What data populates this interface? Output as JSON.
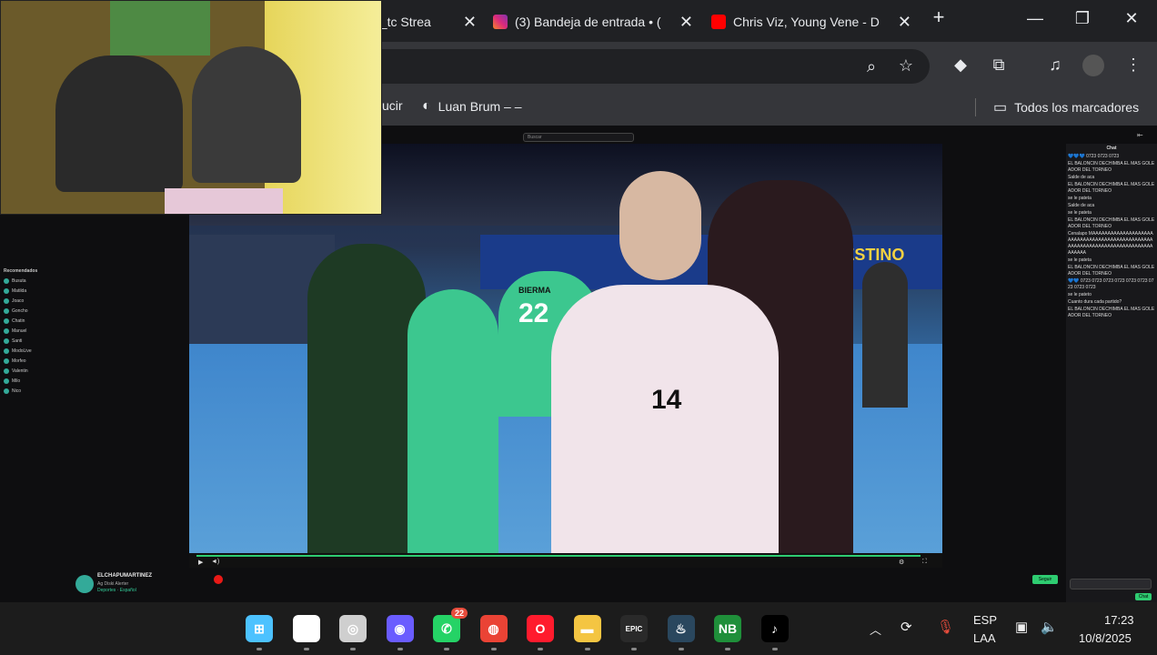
{
  "browser": {
    "tabs": [
      {
        "title": "a_tc Strea",
        "favicon_color": "#9146ff"
      },
      {
        "title": "(3) Bandeja de entrada • (",
        "favicon_color": "#e1306c"
      },
      {
        "title": "Chris Viz, Young Vene - D",
        "favicon_color": "#ff0000"
      }
    ],
    "new_tab_label": "+",
    "window_controls": {
      "minimize": "—",
      "maximize": "❐",
      "close": "✕"
    },
    "bookmarks": [
      {
        "label": "ucir",
        "icon": "bookmark"
      },
      {
        "label": "Luan Brum – –",
        "icon": "globe-icon"
      }
    ],
    "all_bookmarks_label": "Todos los marcadores"
  },
  "stream": {
    "search_placeholder": "Buscar",
    "channel_name": "ELCHAPUMARTINEZ",
    "channel_subtitle": "Ag Diski Alerter",
    "channel_category": "Deportes · Español",
    "follow_label": "Seguir",
    "chat_title": "Chat",
    "chat_send_label": "Chat",
    "jersey_number": "14",
    "jersey_back_number": "22",
    "jersey_back_name": "BIERMA",
    "banner_text": "A TU DESTINO"
  },
  "left_nav": {
    "section_title": "Recomendados",
    "channels": [
      "Busuta",
      "Matilda",
      "Joaco",
      "Goncho",
      "Chatin",
      "Manuel",
      "Santi",
      "ModoLive",
      "Morfeo",
      "Valentin",
      "Milo",
      "Nico"
    ]
  },
  "chat_messages": [
    "💙💙💙 0723 0723 0723",
    "EL BALONCIN DECHIMBA EL MAS GOLEADOR DEL TORNEO",
    "Salde de aca",
    "EL BALONCIN DECHIMBA EL MAS GOLEADOR DEL TORNEO",
    "se le pateta",
    "Salde de aca",
    "se le pateta",
    "EL BALONCIN DECHIMBA EL MAS GOLEADOR DEL TORNEO",
    "Cenalapo MAAAAAAAAAAAAAAAAAAAAAAAAAAAAAAAAAAAAAAAAAAAAAAAAAAAAAAAAAAAAAAAAAAAAAAAAAAAAAAAAAA",
    "se le pateta",
    "EL BALONCIN DECHIMBA EL MAS GOLEADOR DEL TORNEO",
    "💙💙 0723 0723 0723 0723 0723 0723 0723 0723 0723",
    "se le pateto",
    "Cuanto dura cada partido?",
    "EL BALONCIN DECHIMBA EL MAS GOLEADOR DEL TORNEO"
  ],
  "taskbar": {
    "apps": [
      {
        "name": "windows-start-icon",
        "label": "⊞",
        "color": "#4cc2ff"
      },
      {
        "name": "search-icon",
        "label": "⌕",
        "color": "#ffffff"
      },
      {
        "name": "obs-icon",
        "label": "◎",
        "color": "#cfcfcf"
      },
      {
        "name": "browser-circle-icon",
        "label": "◉",
        "color": "#6a5cff"
      },
      {
        "name": "whatsapp-icon",
        "label": "✆",
        "color": "#25d366",
        "badge": "22"
      },
      {
        "name": "chrome-icon",
        "label": "◍",
        "color": "#ea4335"
      },
      {
        "name": "opera-icon",
        "label": "O",
        "color": "#ff1b2d"
      },
      {
        "name": "file-explorer-icon",
        "label": "▬",
        "color": "#f4c542"
      },
      {
        "name": "epic-games-icon",
        "label": "EPIC",
        "color": "#2a2a2a"
      },
      {
        "name": "steam-icon",
        "label": "♨",
        "color": "#2a475e"
      },
      {
        "name": "nb-icon",
        "label": "NB",
        "color": "#1f8f3a"
      },
      {
        "name": "tiktok-icon",
        "label": "♪",
        "color": "#000000"
      }
    ],
    "language": "ESP",
    "language_sub": "LAA",
    "time": "17:23",
    "date": "10/8/2025"
  }
}
